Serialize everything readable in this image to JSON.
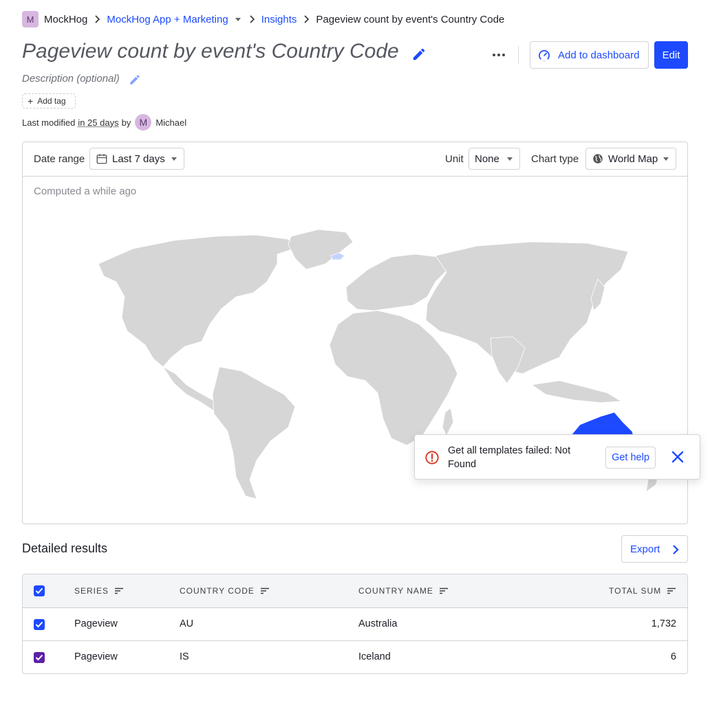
{
  "breadcrumbs": {
    "avatar_initial": "M",
    "org": "MockHog",
    "project": "MockHog App + Marketing",
    "section": "Insights",
    "current": "Pageview count by event's Country Code"
  },
  "header": {
    "title": "Pageview count by event's Country Code",
    "description_placeholder": "Description (optional)",
    "add_to_dashboard_label": "Add to dashboard",
    "edit_label": "Edit",
    "add_tag_label": "Add tag",
    "modified_prefix": "Last modified",
    "modified_when": "in 25 days",
    "modified_by": "by",
    "user_initial": "M",
    "user_name": "Michael"
  },
  "toolbar": {
    "date_range_label": "Date range",
    "date_range_value": "Last 7 days",
    "unit_label": "Unit",
    "unit_value": "None",
    "chart_type_label": "Chart type",
    "chart_type_value": "World Map"
  },
  "computed_text": "Computed a while ago",
  "map": {
    "highlighted": [
      {
        "country": "AU",
        "color": "#1d4aff"
      },
      {
        "country": "IS",
        "color": "#c4d4ff"
      }
    ],
    "base_color": "#d6d6d6"
  },
  "toast": {
    "message": "Get all templates failed: Not Found",
    "help_label": "Get help",
    "error_color": "#d9311f"
  },
  "results": {
    "title": "Detailed results",
    "export_label": "Export",
    "columns": [
      "SERIES",
      "COUNTRY CODE",
      "COUNTRY NAME",
      "TOTAL SUM"
    ],
    "rows": [
      {
        "series": "Pageview",
        "code": "AU",
        "name": "Australia",
        "total": "1,732",
        "checkbox_color": "#1d4aff"
      },
      {
        "series": "Pageview",
        "code": "IS",
        "name": "Iceland",
        "total": "6",
        "checkbox_color": "#5b21a6"
      }
    ]
  },
  "colors": {
    "primary": "#1d4aff",
    "avatar_bg": "#d7b7e0"
  }
}
